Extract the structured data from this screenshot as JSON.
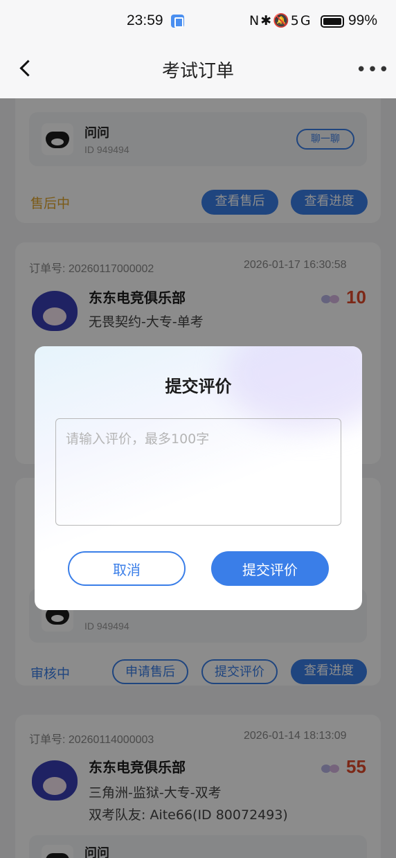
{
  "status_bar": {
    "time": "23:59",
    "system_icons": "N✱🔕5G",
    "battery_pct": "99%"
  },
  "nav": {
    "title": "考试订单",
    "more": "•••"
  },
  "orders": {
    "o1": {
      "member_name": "问问",
      "member_id": "ID 949494",
      "chat": "聊一聊",
      "status": "售后中",
      "btn_view_aftersale": "查看售后",
      "btn_view_progress": "查看进度"
    },
    "o2": {
      "order_no": "订单号: 20260117000002",
      "time": "2026-01-17 16:30:58",
      "club": "东东电竞俱乐部",
      "desc": "无畏契约-大专-单考",
      "price": "10"
    },
    "o3": {
      "member_id": "ID 949494",
      "status": "审核中",
      "btn_apply_aftersale": "申请售后",
      "btn_submit_review": "提交评价",
      "btn_view_progress": "查看进度"
    },
    "o4": {
      "order_no": "订单号: 20260114000003",
      "time": "2026-01-14 18:13:09",
      "club": "东东电竞俱乐部",
      "desc": "三角洲-监狱-大专-双考",
      "teammate": "双考队友: Aite66(ID 80072493)",
      "price": "55",
      "member_name": "问问"
    }
  },
  "dialog": {
    "title": "提交评价",
    "placeholder": "请输入评价，最多100字",
    "value": "",
    "cancel": "取消",
    "submit": "提交评价"
  },
  "colors": {
    "accent": "#3a7ee8",
    "price": "#e2492b",
    "status_aftersale": "#e0a52a",
    "status_review": "#3a7ee8"
  }
}
